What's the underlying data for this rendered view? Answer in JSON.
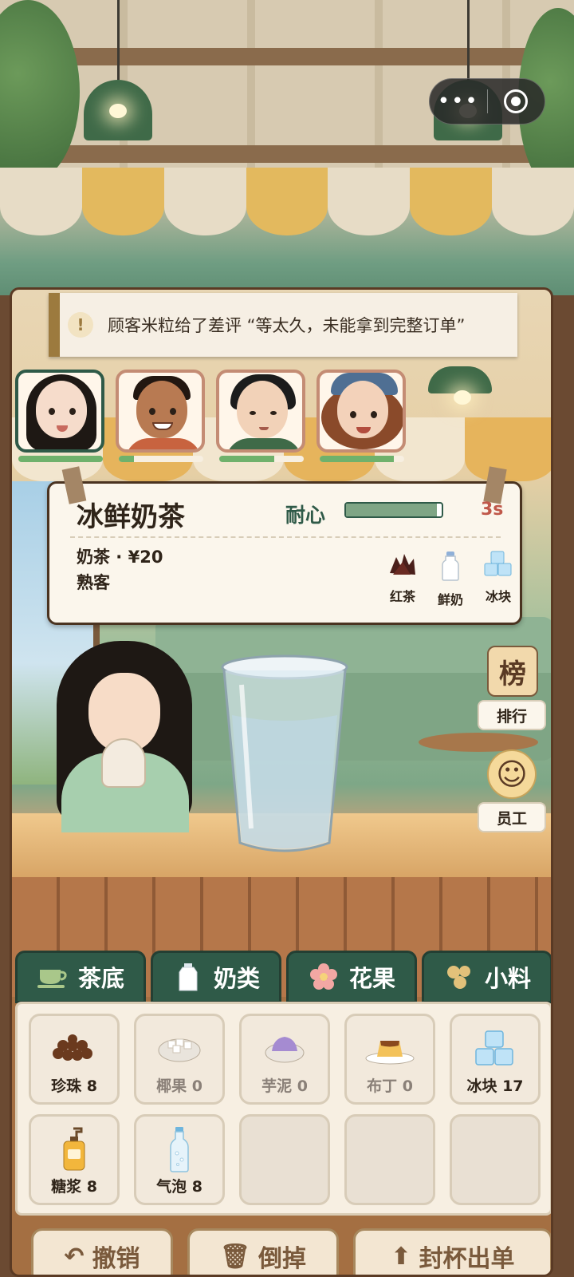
{
  "capsule": {
    "more_icon": "more-dots-icon",
    "close_icon": "target-ring-icon"
  },
  "notice": {
    "icon": "exclamation-icon",
    "text": "顾客米粒给了差评 “等太久，未能拿到完整订单”"
  },
  "customers": [
    {
      "name": "girl-longhair",
      "patience_pct": 100,
      "active": true
    },
    {
      "name": "boy-curly",
      "patience_pct": 18
    },
    {
      "name": "boy-blackhair",
      "patience_pct": 65
    },
    {
      "name": "girl-beret",
      "patience_pct": 88
    }
  ],
  "order": {
    "drink_name": "冰鲜奶茶",
    "patience_label": "耐心",
    "patience_pct": 95,
    "time_left": "3s",
    "category_price": "奶茶 · ¥20",
    "customer_type": "熟客",
    "ingredients": [
      {
        "label": "红茶",
        "icon": "black-tea-leaves-icon"
      },
      {
        "label": "鲜奶",
        "icon": "milk-bottle-icon"
      },
      {
        "label": "冰块",
        "icon": "ice-cubes-icon"
      }
    ]
  },
  "side": {
    "rank_badge": "榜",
    "rank_label": "排行",
    "staff_label": "员工"
  },
  "tabs": [
    {
      "label": "茶底",
      "icon": "teacup-icon"
    },
    {
      "label": "奶类",
      "icon": "milk-carton-icon"
    },
    {
      "label": "花果",
      "icon": "flower-icon"
    },
    {
      "label": "小料",
      "icon": "toppings-icon"
    }
  ],
  "inventory": [
    {
      "label": "珍珠  8",
      "icon": "tapioca-pearls-icon",
      "count": 8
    },
    {
      "label": "椰果  0",
      "icon": "coconut-jelly-icon",
      "count": 0
    },
    {
      "label": "芋泥  0",
      "icon": "taro-paste-icon",
      "count": 0
    },
    {
      "label": "布丁  0",
      "icon": "pudding-icon",
      "count": 0
    },
    {
      "label": "冰块  17",
      "icon": "ice-cubes-icon",
      "count": 17
    },
    {
      "label": "糖浆  8",
      "icon": "syrup-pump-bottle-icon",
      "count": 8
    },
    {
      "label": "气泡  8",
      "icon": "sparkling-water-bottle-icon",
      "count": 8
    }
  ],
  "actions": [
    {
      "label": "撤销",
      "icon": "undo-arrow-icon"
    },
    {
      "label": "倒掉",
      "icon": "trash-icon"
    },
    {
      "label": "封杯出单",
      "icon": "seal-cup-icon"
    }
  ]
}
